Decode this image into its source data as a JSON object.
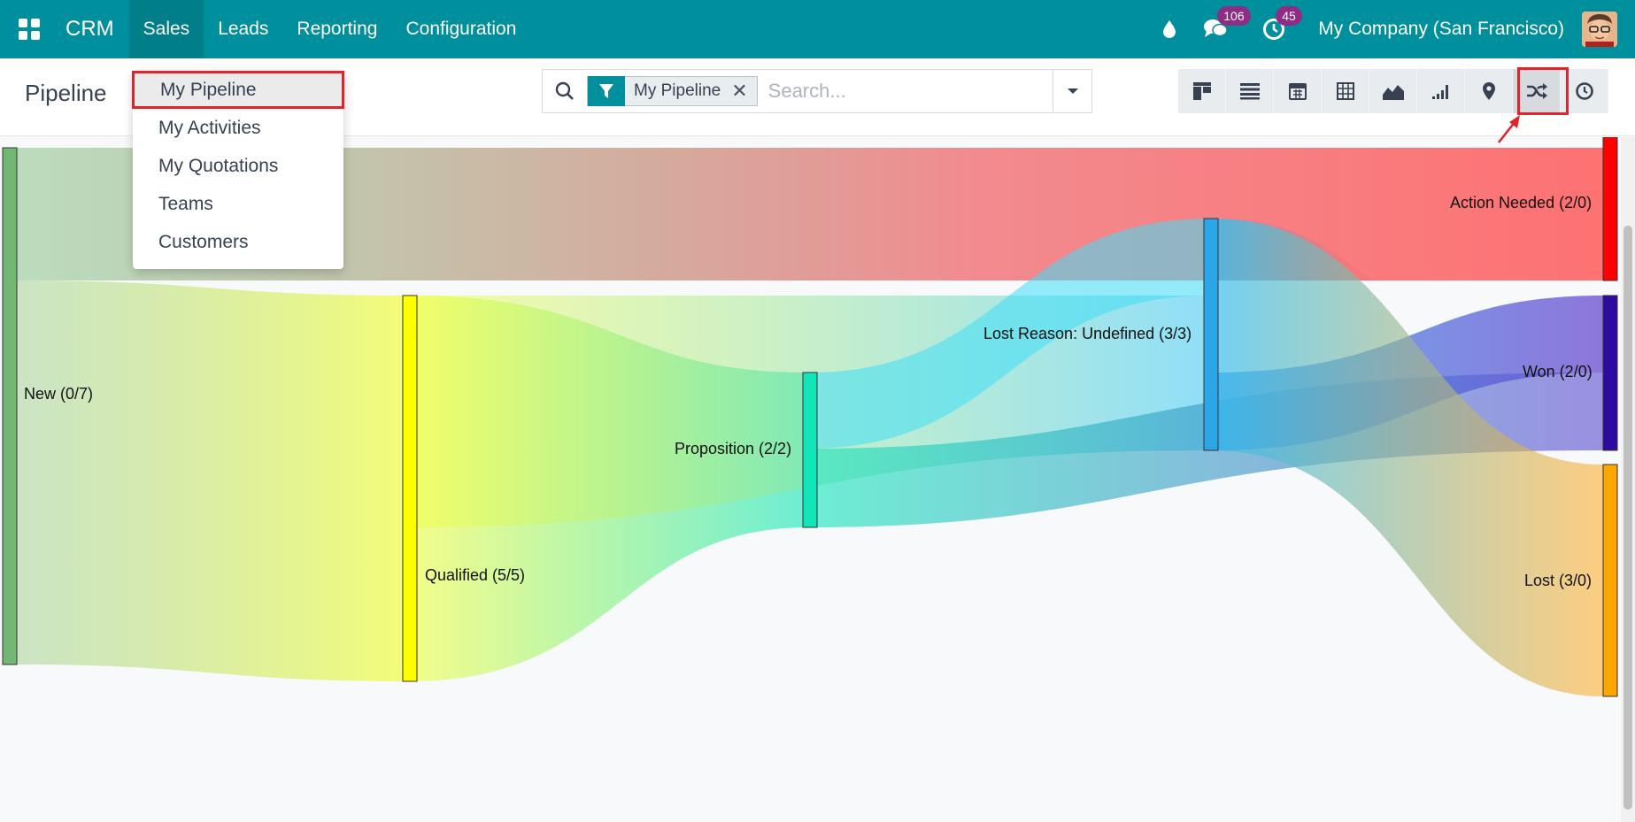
{
  "navbar": {
    "app_name": "CRM",
    "menu": [
      {
        "label": "Sales",
        "active": true
      },
      {
        "label": "Leads"
      },
      {
        "label": "Reporting"
      },
      {
        "label": "Configuration"
      }
    ],
    "messages_badge": "106",
    "activities_badge": "45",
    "company": "My Company (San Francisco)"
  },
  "dropdown": {
    "items": [
      "My Pipeline",
      "My Activities",
      "My Quotations",
      "Teams",
      "Customers"
    ]
  },
  "control_panel": {
    "title": "Pipeline",
    "facet": "My Pipeline",
    "facet_remove": "✕",
    "search_placeholder": "Search...",
    "views": [
      "kanban",
      "list",
      "calendar",
      "pivot",
      "graph",
      "cohort",
      "map",
      "sankey",
      "activity"
    ]
  },
  "sankey": {
    "nodes": [
      {
        "id": "new",
        "label": "New (0/7)",
        "color": "#72b772"
      },
      {
        "id": "qualified",
        "label": "Qualified (5/5)",
        "color": "#ffff00"
      },
      {
        "id": "proposition",
        "label": "Proposition (2/2)",
        "color": "#10e6b9"
      },
      {
        "id": "lost_reason",
        "label": "Lost Reason: Undefined (3/3)",
        "color": "#2aa5e8"
      },
      {
        "id": "action_needed",
        "label": "Action Needed (2/0)",
        "color": "#ff0000"
      },
      {
        "id": "won",
        "label": "Won (2/0)",
        "color": "#2d0aa0"
      },
      {
        "id": "lost",
        "label": "Lost (3/0)",
        "color": "#ffa500"
      }
    ]
  },
  "colors": {
    "brand": "#008f9c",
    "highlight": "#e1242c",
    "badge": "#8e2c86"
  }
}
